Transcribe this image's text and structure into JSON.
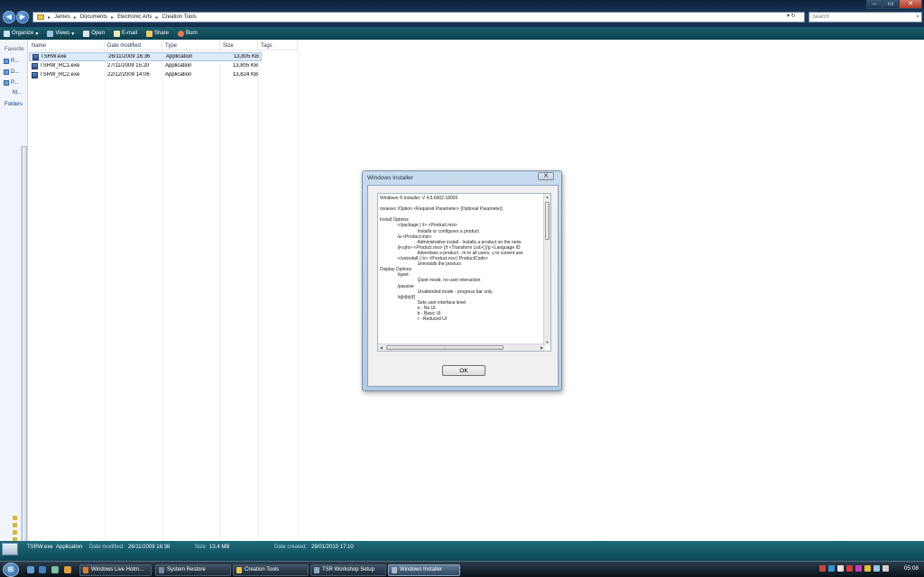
{
  "window": {
    "controls": {
      "minimize": "–",
      "maximize": "▭",
      "close": "✕"
    }
  },
  "address": {
    "crumbs": [
      "James",
      "Documents",
      "Electronic Arts",
      "Creation Tools"
    ],
    "separator": "▸",
    "tools": "▾  ↻"
  },
  "search": {
    "placeholder": "Search"
  },
  "toolbar": {
    "organize": "Organize",
    "views": "Views",
    "open": "Open",
    "email": "E-mail",
    "share": "Share",
    "burn": "Burn"
  },
  "nav": {
    "favorites": "Favorite",
    "items": [
      "R...",
      "D...",
      "P...",
      "M..."
    ],
    "folders": "Folders"
  },
  "columns": {
    "name": "Name",
    "date": "Date modified",
    "type": "Type",
    "size": "Size",
    "tags": "Tags"
  },
  "files": [
    {
      "name": "TSRW.exe",
      "date": "26/11/2009 16:36",
      "type": "Application",
      "size": "13,805 KB"
    },
    {
      "name": "TSRW_RC1.exe",
      "date": "27/11/2009 15:20",
      "type": "Application",
      "size": "13,805 KB"
    },
    {
      "name": "TSRW_RC2.exe",
      "date": "22/12/2009 14:06",
      "type": "Application",
      "size": "13,824 KB"
    }
  ],
  "dialog": {
    "title": "Windows Installer",
    "close": "✕",
    "text": "Windows ® Installer. V 4.5.6002.18005\n\nmsiexec /Option <Required Parameter> [Optional Parameter]\n\nInstall Options\n              </package | /i> <Product.msi>\n                              Installs or configures a product\n              /a <Product.msi>\n                              Administrative install - Installs a product on the netw\n              /j<u|m> <Product.msi> [/t <Transform List>] [/g <Language ID\n                              Advertises a product - m to all users, u to current use\n              </uninstall | /x> <Product.msi | ProductCode>\n                              Uninstalls the product\nDisplay Options\n              /quiet\n                              Quiet mode, no user interaction\n              /passive\n                              Unattended mode - progress bar only\n              /q[n|b|r|f]\n                              Sets user interface level\n                              n - No UI\n                              b - Basic UI\n                              r - Reduced UI",
    "ok": "OK"
  },
  "details": {
    "name": "TSRW.exe",
    "kind": "Application",
    "modified_label": "Date modified:",
    "modified": "26/11/2009 16:36",
    "size_label": "Size:",
    "size": "13.4 MB",
    "created_label": "Date created:",
    "created": "28/01/2010 17:10"
  },
  "taskbar": {
    "start": "⊞",
    "tasks": [
      {
        "label": "Windows Live Hotm...",
        "active": false
      },
      {
        "label": "System Restore",
        "active": false
      },
      {
        "label": "Creation Tools",
        "active": false
      },
      {
        "label": "TSR Workshop Setup",
        "active": false
      },
      {
        "label": "Windows Installer",
        "active": true
      }
    ],
    "clock": "05:08"
  }
}
